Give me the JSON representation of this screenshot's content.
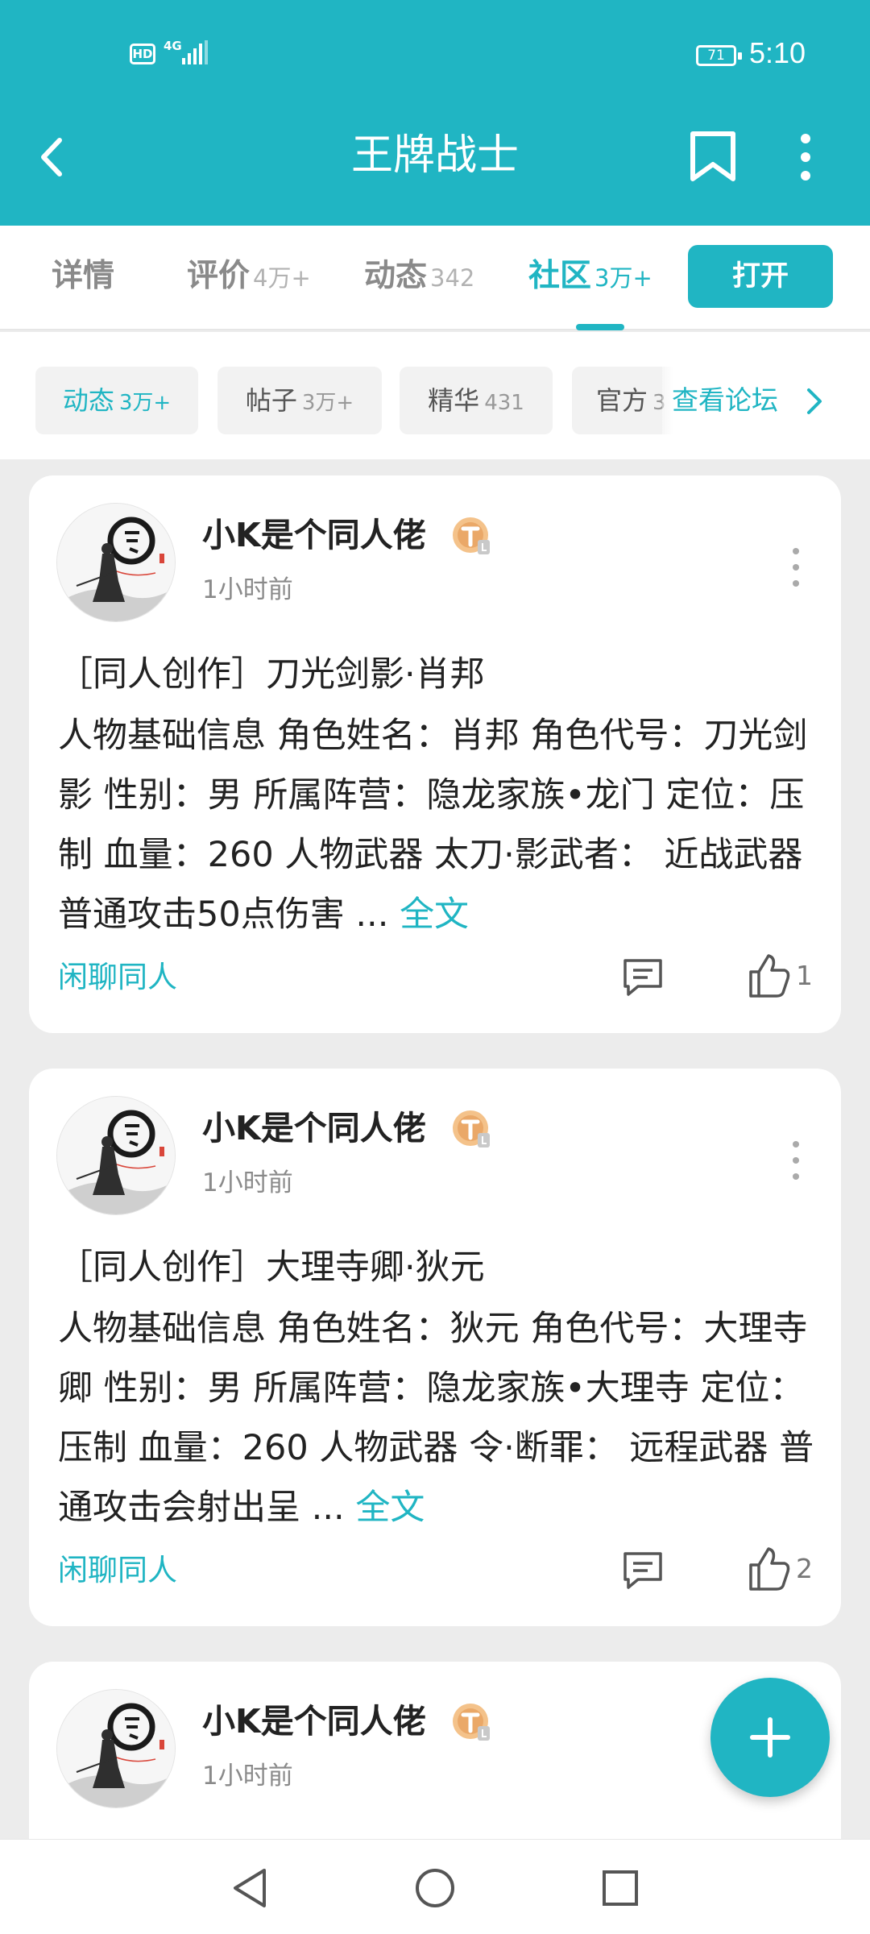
{
  "status_bar": {
    "hd": "HD",
    "network": "4G",
    "battery": "71",
    "time": "5:10"
  },
  "header": {
    "title": "王牌战士"
  },
  "tabs": [
    {
      "label": "详情",
      "count": ""
    },
    {
      "label": "评价",
      "count": "4万+"
    },
    {
      "label": "动态",
      "count": "342"
    },
    {
      "label": "社区",
      "count": "3万+",
      "active": true
    }
  ],
  "open_button": "打开",
  "filters": [
    {
      "label": "动态",
      "count": "3万+",
      "active": true
    },
    {
      "label": "帖子",
      "count": "3万+"
    },
    {
      "label": "精华",
      "count": "431"
    },
    {
      "label": "官方",
      "count": "3"
    }
  ],
  "forum_link": "查看论坛",
  "posts": [
    {
      "author": "小K是个同人佬",
      "time": "1小时前",
      "title": "［同人创作］刀光剑影·肖邦",
      "excerpt": "人物基础信息 角色姓名：肖邦 角色代号：刀光剑影 性别：男 所属阵营：隐龙家族•龙门 定位：压制 血量：260 人物武器 太刀·影武者： 近战武器 普通攻击50点伤害 ...",
      "more": "全文",
      "tag": "闲聊同人",
      "likes": "1"
    },
    {
      "author": "小K是个同人佬",
      "time": "1小时前",
      "title": "［同人创作］大理寺卿·狄元",
      "excerpt": "人物基础信息 角色姓名：狄元 角色代号：大理寺卿 性别：男 所属阵营：隐龙家族•大理寺 定位：压制 血量：260 人物武器 令·断罪： 远程武器 普通攻击会射出呈 ...",
      "more": "全文",
      "tag": "闲聊同人",
      "likes": "2"
    },
    {
      "author": "小K是个同人佬",
      "time": "1小时前"
    }
  ],
  "colors": {
    "accent": "#20b5c3",
    "badge": "#f2b374"
  },
  "icons": [
    "back-arrow-icon",
    "bookmark-icon",
    "more-vertical-icon",
    "chevron-right-icon",
    "comment-icon",
    "thumbs-up-icon",
    "plus-icon",
    "level-badge-icon"
  ]
}
